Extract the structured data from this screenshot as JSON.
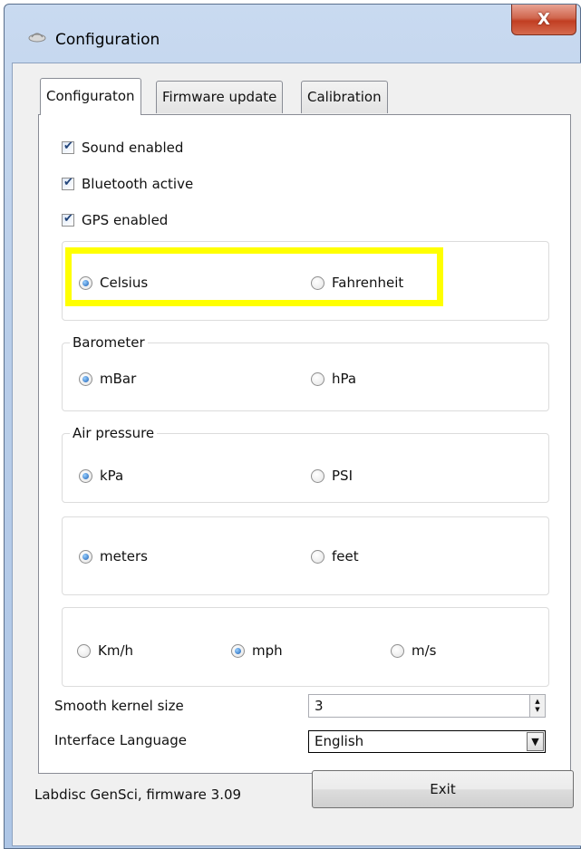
{
  "window": {
    "title": "Configuration",
    "close_label": "X"
  },
  "tabs": [
    {
      "label": "Configuraton",
      "active": true
    },
    {
      "label": "Firmware update",
      "active": false
    },
    {
      "label": "Calibration",
      "active": false
    }
  ],
  "checkboxes": [
    {
      "label": "Sound enabled",
      "checked": true
    },
    {
      "label": "Bluetooth active",
      "checked": true
    },
    {
      "label": "GPS enabled",
      "checked": true
    }
  ],
  "groups": {
    "temperature": {
      "legend": "",
      "options": [
        {
          "label": "Celsius",
          "checked": true
        },
        {
          "label": "Fahrenheit",
          "checked": false
        }
      ]
    },
    "barometer": {
      "legend": "Barometer",
      "options": [
        {
          "label": "mBar",
          "checked": true
        },
        {
          "label": "hPa",
          "checked": false
        }
      ]
    },
    "air_pressure": {
      "legend": "Air pressure",
      "options": [
        {
          "label": "kPa",
          "checked": true
        },
        {
          "label": "PSI",
          "checked": false
        }
      ]
    },
    "distance": {
      "legend": "",
      "options": [
        {
          "label": "meters",
          "checked": true
        },
        {
          "label": "feet",
          "checked": false
        }
      ]
    },
    "speed": {
      "legend": "",
      "options": [
        {
          "label": "Km/h",
          "checked": false
        },
        {
          "label": "mph",
          "checked": true
        },
        {
          "label": "m/s",
          "checked": false
        }
      ]
    }
  },
  "smooth_kernel": {
    "label": "Smooth kernel size",
    "value": "3"
  },
  "language": {
    "label": "Interface Language",
    "value": "English"
  },
  "footer": {
    "device_info": "Labdisc GenSci, firmware 3.09",
    "exit_label": "Exit"
  },
  "colors": {
    "highlight": "#ffff00",
    "close_button": "#c13e22"
  },
  "icons": {
    "app": "app-icon",
    "close": "close-icon",
    "spin_up": "spin-up-icon",
    "spin_down": "spin-down-icon",
    "dropdown": "chevron-down-icon"
  }
}
